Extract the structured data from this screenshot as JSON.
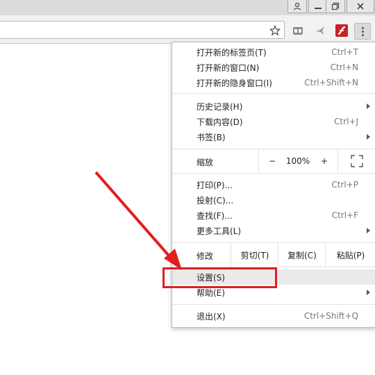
{
  "menu": {
    "items": [
      {
        "label": "打开新的标签页(T)",
        "shortcut": "Ctrl+T"
      },
      {
        "label": "打开新的窗口(N)",
        "shortcut": "Ctrl+N"
      },
      {
        "label": "打开新的隐身窗口(I)",
        "shortcut": "Ctrl+Shift+N"
      },
      {
        "label": "历史记录(H)",
        "shortcut": ""
      },
      {
        "label": "下载内容(D)",
        "shortcut": "Ctrl+J"
      },
      {
        "label": "书签(B)",
        "shortcut": ""
      },
      {
        "label": "打印(P)...",
        "shortcut": "Ctrl+P"
      },
      {
        "label": "投射(C)...",
        "shortcut": ""
      },
      {
        "label": "查找(F)...",
        "shortcut": "Ctrl+F"
      },
      {
        "label": "更多工具(L)",
        "shortcut": ""
      },
      {
        "label": "设置(S)",
        "shortcut": ""
      },
      {
        "label": "帮助(E)",
        "shortcut": ""
      },
      {
        "label": "退出(X)",
        "shortcut": "Ctrl+Shift+Q"
      }
    ],
    "zoom": {
      "label": "缩放",
      "minus": "−",
      "value": "100%",
      "plus": "+"
    },
    "edit": {
      "label": "修改",
      "cut": "剪切(T)",
      "copy": "复制(C)",
      "paste": "粘贴(P)"
    }
  },
  "colors": {
    "annotation": "#e01e1e",
    "highlight": "#eaeaea"
  }
}
